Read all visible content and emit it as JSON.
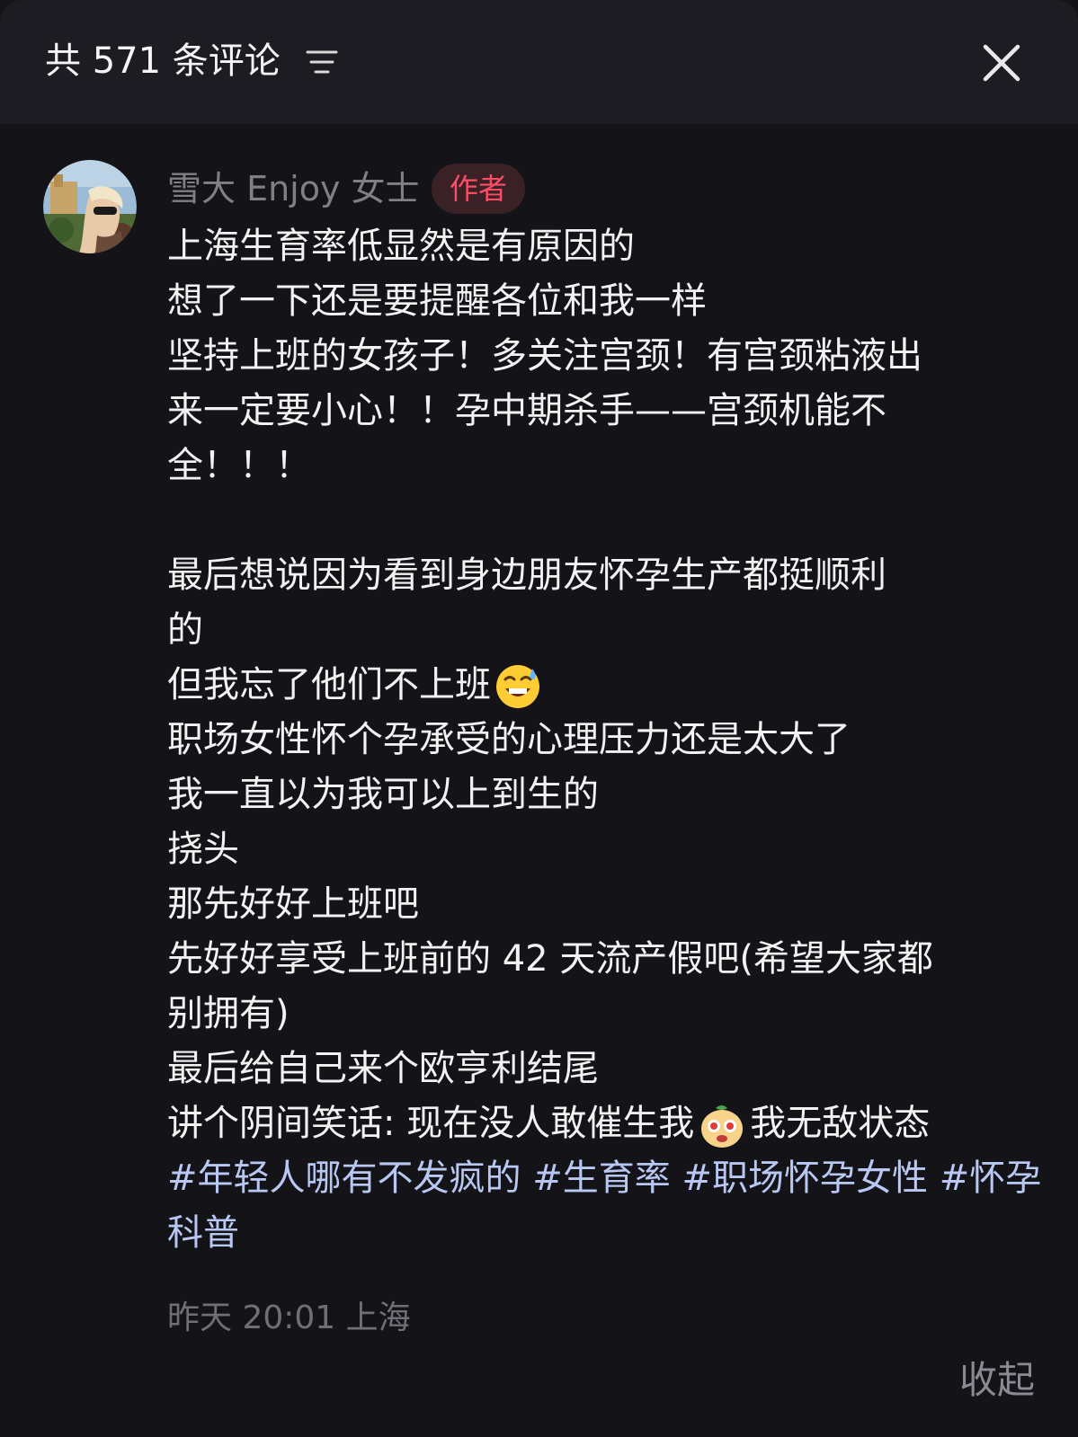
{
  "header": {
    "title": "共 571 条评论",
    "filter_icon": "sort-lines-icon",
    "close_icon": "close-icon"
  },
  "comment": {
    "author": "雪大 Enjoy 女士",
    "badge": "作者",
    "lines": [
      "上海生育率低显然是有原因的",
      "想了一下还是要提醒各位和我一样",
      "坚持上班的女孩子！多关注宫颈！有宫颈粘液出",
      "来一定要小心！！孕中期杀手——宫颈机能不",
      "全！！！",
      "",
      "最后想说因为看到身边朋友怀孕生产都挺顺利",
      "的",
      "但我忘了他们不上班",
      "职场女性怀个孕承受的心理压力还是太大了",
      "我一直以为我可以上到生的",
      "挠头",
      "那先好好上班吧",
      "先好好享受上班前的 42 天流产假吧(希望大家都",
      "别拥有)",
      "最后给自己来个欧亨利结尾",
      "讲个阴间笑话: 现在没人敢催生我",
      "我无敌状态"
    ],
    "emoji_sweat": "sweat-smile-emoji",
    "emoji_sticker": "cute-face-sticker-emoji",
    "tags": [
      "#年轻人哪有不发疯的",
      "#生育率",
      "#职场怀孕女性",
      "#怀孕科普"
    ],
    "time": "昨天 20:01",
    "location": "上海",
    "collapse_label": "收起"
  },
  "colors": {
    "background": "#131318",
    "header_bg": "#1c1c22",
    "badge_text": "#ff4d67",
    "tag_text": "#b8c8f2"
  }
}
